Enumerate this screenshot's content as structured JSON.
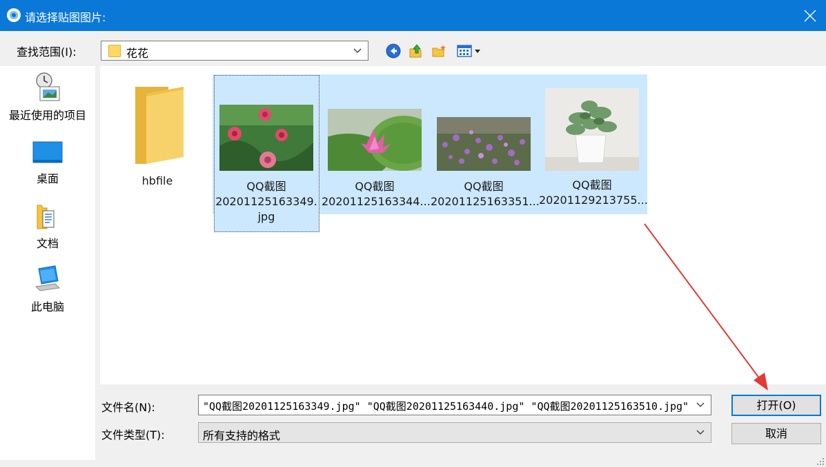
{
  "window": {
    "title": "请选择贴图图片:"
  },
  "toolbar": {
    "lookin_label": "查找范围(I):",
    "lookin_value": "花花",
    "icons": [
      "back-icon",
      "up-folder-icon",
      "new-folder-icon",
      "view-menu-icon"
    ]
  },
  "places": [
    {
      "label": "最近使用的项目",
      "icon": "recent-items-icon"
    },
    {
      "label": "桌面",
      "icon": "desktop-icon"
    },
    {
      "label": "文档",
      "icon": "documents-icon"
    },
    {
      "label": "此电脑",
      "icon": "this-pc-icon"
    }
  ],
  "files": [
    {
      "name_line1": "hbfile",
      "name_line2": "",
      "name_line3": "",
      "type": "folder",
      "selected": false
    },
    {
      "name_line1": "QQ截图",
      "name_line2": "20201125163349.",
      "name_line3": "jpg",
      "type": "image",
      "selected": true
    },
    {
      "name_line1": "QQ截图",
      "name_line2": "20201125163344...",
      "name_line3": "",
      "type": "image",
      "selected": true
    },
    {
      "name_line1": "QQ截图",
      "name_line2": "20201125163351...",
      "name_line3": "",
      "type": "image",
      "selected": true
    },
    {
      "name_line1": "QQ截图",
      "name_line2": "20201129213755...",
      "name_line3": "",
      "type": "image",
      "selected": true
    }
  ],
  "bottom": {
    "filename_label": "文件名(N):",
    "filename_value": "\"QQ截图20201125163349.jpg\" \"QQ截图20201125163440.jpg\" \"QQ截图20201125163510.jpg\"",
    "filetype_label": "文件类型(T):",
    "filetype_value": "所有支持的格式",
    "open_label": "打开(O)",
    "cancel_label": "取消"
  },
  "colors": {
    "titlebar": "#0a78d7",
    "selection": "#cce8ff",
    "annotation_arrow": "#e53935"
  }
}
